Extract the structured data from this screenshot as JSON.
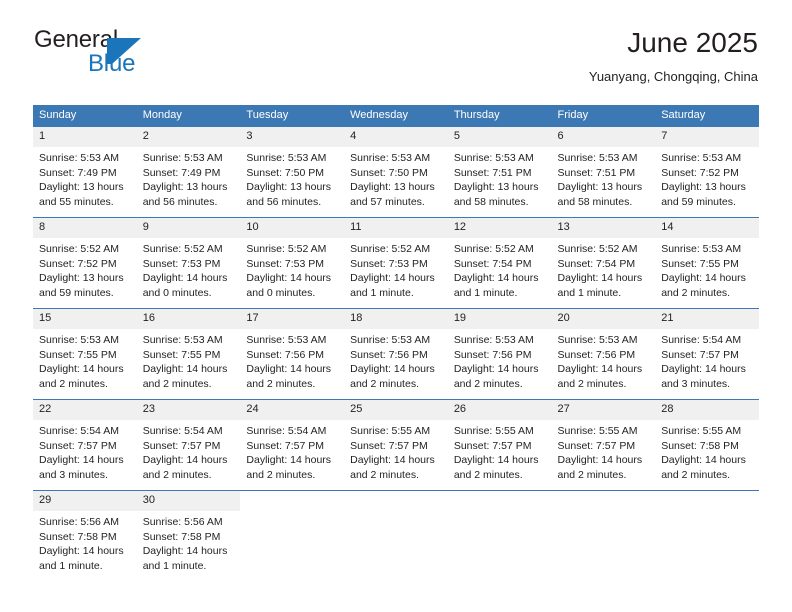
{
  "brand": {
    "name_part1": "General",
    "name_part2": "Blue",
    "accent_color": "#1b75bb"
  },
  "header": {
    "month_title": "June 2025",
    "location": "Yuanyang, Chongqing, China"
  },
  "theme": {
    "header_row_bg": "#3c78b4",
    "daynum_bg": "#f0f0f0",
    "text_color": "#231f20"
  },
  "weekdays": [
    "Sunday",
    "Monday",
    "Tuesday",
    "Wednesday",
    "Thursday",
    "Friday",
    "Saturday"
  ],
  "labels": {
    "sunrise_prefix": "Sunrise:",
    "sunset_prefix": "Sunset:",
    "daylight_prefix": "Daylight:"
  },
  "weeks": [
    [
      {
        "day": "1",
        "sunrise": "Sunrise: 5:53 AM",
        "sunset": "Sunset: 7:49 PM",
        "daylight_line1": "Daylight: 13 hours",
        "daylight_line2": "and 55 minutes."
      },
      {
        "day": "2",
        "sunrise": "Sunrise: 5:53 AM",
        "sunset": "Sunset: 7:49 PM",
        "daylight_line1": "Daylight: 13 hours",
        "daylight_line2": "and 56 minutes."
      },
      {
        "day": "3",
        "sunrise": "Sunrise: 5:53 AM",
        "sunset": "Sunset: 7:50 PM",
        "daylight_line1": "Daylight: 13 hours",
        "daylight_line2": "and 56 minutes."
      },
      {
        "day": "4",
        "sunrise": "Sunrise: 5:53 AM",
        "sunset": "Sunset: 7:50 PM",
        "daylight_line1": "Daylight: 13 hours",
        "daylight_line2": "and 57 minutes."
      },
      {
        "day": "5",
        "sunrise": "Sunrise: 5:53 AM",
        "sunset": "Sunset: 7:51 PM",
        "daylight_line1": "Daylight: 13 hours",
        "daylight_line2": "and 58 minutes."
      },
      {
        "day": "6",
        "sunrise": "Sunrise: 5:53 AM",
        "sunset": "Sunset: 7:51 PM",
        "daylight_line1": "Daylight: 13 hours",
        "daylight_line2": "and 58 minutes."
      },
      {
        "day": "7",
        "sunrise": "Sunrise: 5:53 AM",
        "sunset": "Sunset: 7:52 PM",
        "daylight_line1": "Daylight: 13 hours",
        "daylight_line2": "and 59 minutes."
      }
    ],
    [
      {
        "day": "8",
        "sunrise": "Sunrise: 5:52 AM",
        "sunset": "Sunset: 7:52 PM",
        "daylight_line1": "Daylight: 13 hours",
        "daylight_line2": "and 59 minutes."
      },
      {
        "day": "9",
        "sunrise": "Sunrise: 5:52 AM",
        "sunset": "Sunset: 7:53 PM",
        "daylight_line1": "Daylight: 14 hours",
        "daylight_line2": "and 0 minutes."
      },
      {
        "day": "10",
        "sunrise": "Sunrise: 5:52 AM",
        "sunset": "Sunset: 7:53 PM",
        "daylight_line1": "Daylight: 14 hours",
        "daylight_line2": "and 0 minutes."
      },
      {
        "day": "11",
        "sunrise": "Sunrise: 5:52 AM",
        "sunset": "Sunset: 7:53 PM",
        "daylight_line1": "Daylight: 14 hours",
        "daylight_line2": "and 1 minute."
      },
      {
        "day": "12",
        "sunrise": "Sunrise: 5:52 AM",
        "sunset": "Sunset: 7:54 PM",
        "daylight_line1": "Daylight: 14 hours",
        "daylight_line2": "and 1 minute."
      },
      {
        "day": "13",
        "sunrise": "Sunrise: 5:52 AM",
        "sunset": "Sunset: 7:54 PM",
        "daylight_line1": "Daylight: 14 hours",
        "daylight_line2": "and 1 minute."
      },
      {
        "day": "14",
        "sunrise": "Sunrise: 5:53 AM",
        "sunset": "Sunset: 7:55 PM",
        "daylight_line1": "Daylight: 14 hours",
        "daylight_line2": "and 2 minutes."
      }
    ],
    [
      {
        "day": "15",
        "sunrise": "Sunrise: 5:53 AM",
        "sunset": "Sunset: 7:55 PM",
        "daylight_line1": "Daylight: 14 hours",
        "daylight_line2": "and 2 minutes."
      },
      {
        "day": "16",
        "sunrise": "Sunrise: 5:53 AM",
        "sunset": "Sunset: 7:55 PM",
        "daylight_line1": "Daylight: 14 hours",
        "daylight_line2": "and 2 minutes."
      },
      {
        "day": "17",
        "sunrise": "Sunrise: 5:53 AM",
        "sunset": "Sunset: 7:56 PM",
        "daylight_line1": "Daylight: 14 hours",
        "daylight_line2": "and 2 minutes."
      },
      {
        "day": "18",
        "sunrise": "Sunrise: 5:53 AM",
        "sunset": "Sunset: 7:56 PM",
        "daylight_line1": "Daylight: 14 hours",
        "daylight_line2": "and 2 minutes."
      },
      {
        "day": "19",
        "sunrise": "Sunrise: 5:53 AM",
        "sunset": "Sunset: 7:56 PM",
        "daylight_line1": "Daylight: 14 hours",
        "daylight_line2": "and 2 minutes."
      },
      {
        "day": "20",
        "sunrise": "Sunrise: 5:53 AM",
        "sunset": "Sunset: 7:56 PM",
        "daylight_line1": "Daylight: 14 hours",
        "daylight_line2": "and 2 minutes."
      },
      {
        "day": "21",
        "sunrise": "Sunrise: 5:54 AM",
        "sunset": "Sunset: 7:57 PM",
        "daylight_line1": "Daylight: 14 hours",
        "daylight_line2": "and 3 minutes."
      }
    ],
    [
      {
        "day": "22",
        "sunrise": "Sunrise: 5:54 AM",
        "sunset": "Sunset: 7:57 PM",
        "daylight_line1": "Daylight: 14 hours",
        "daylight_line2": "and 3 minutes."
      },
      {
        "day": "23",
        "sunrise": "Sunrise: 5:54 AM",
        "sunset": "Sunset: 7:57 PM",
        "daylight_line1": "Daylight: 14 hours",
        "daylight_line2": "and 2 minutes."
      },
      {
        "day": "24",
        "sunrise": "Sunrise: 5:54 AM",
        "sunset": "Sunset: 7:57 PM",
        "daylight_line1": "Daylight: 14 hours",
        "daylight_line2": "and 2 minutes."
      },
      {
        "day": "25",
        "sunrise": "Sunrise: 5:55 AM",
        "sunset": "Sunset: 7:57 PM",
        "daylight_line1": "Daylight: 14 hours",
        "daylight_line2": "and 2 minutes."
      },
      {
        "day": "26",
        "sunrise": "Sunrise: 5:55 AM",
        "sunset": "Sunset: 7:57 PM",
        "daylight_line1": "Daylight: 14 hours",
        "daylight_line2": "and 2 minutes."
      },
      {
        "day": "27",
        "sunrise": "Sunrise: 5:55 AM",
        "sunset": "Sunset: 7:57 PM",
        "daylight_line1": "Daylight: 14 hours",
        "daylight_line2": "and 2 minutes."
      },
      {
        "day": "28",
        "sunrise": "Sunrise: 5:55 AM",
        "sunset": "Sunset: 7:58 PM",
        "daylight_line1": "Daylight: 14 hours",
        "daylight_line2": "and 2 minutes."
      }
    ],
    [
      {
        "day": "29",
        "sunrise": "Sunrise: 5:56 AM",
        "sunset": "Sunset: 7:58 PM",
        "daylight_line1": "Daylight: 14 hours",
        "daylight_line2": "and 1 minute."
      },
      {
        "day": "30",
        "sunrise": "Sunrise: 5:56 AM",
        "sunset": "Sunset: 7:58 PM",
        "daylight_line1": "Daylight: 14 hours",
        "daylight_line2": "and 1 minute."
      },
      {
        "day": "",
        "sunrise": "",
        "sunset": "",
        "daylight_line1": "",
        "daylight_line2": ""
      },
      {
        "day": "",
        "sunrise": "",
        "sunset": "",
        "daylight_line1": "",
        "daylight_line2": ""
      },
      {
        "day": "",
        "sunrise": "",
        "sunset": "",
        "daylight_line1": "",
        "daylight_line2": ""
      },
      {
        "day": "",
        "sunrise": "",
        "sunset": "",
        "daylight_line1": "",
        "daylight_line2": ""
      },
      {
        "day": "",
        "sunrise": "",
        "sunset": "",
        "daylight_line1": "",
        "daylight_line2": ""
      }
    ]
  ]
}
